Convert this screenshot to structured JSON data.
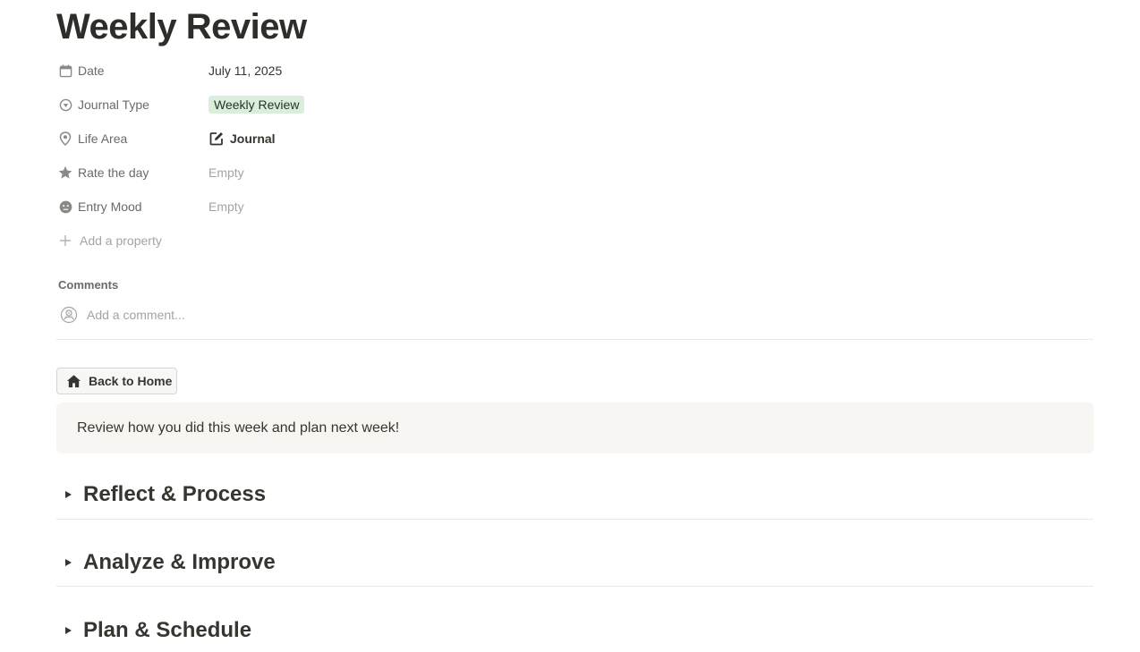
{
  "page": {
    "title": "Weekly Review"
  },
  "properties": [
    {
      "key": "Date",
      "icon": "calendar-icon",
      "value": "July 11, 2025"
    },
    {
      "key": "Journal Type",
      "icon": "select-icon",
      "value": "Weekly Review"
    },
    {
      "key": "Life Area",
      "icon": "location-pin-icon",
      "value": "Journal",
      "value_icon": "edit-note-icon"
    },
    {
      "key": "Rate the day",
      "icon": "star-icon",
      "value": "Empty"
    },
    {
      "key": "Entry Mood",
      "icon": "mood-face-icon",
      "value": "Empty"
    }
  ],
  "add_property": {
    "label": "Add a property",
    "icon": "plus-icon"
  },
  "comments": {
    "label": "Comments",
    "placeholder": "Add a comment...",
    "avatar_icon": "avatar-icon"
  },
  "back_button": {
    "label": "Back to Home",
    "icon": "home-icon"
  },
  "callout": {
    "text": "Review how you did this week and plan next week!"
  },
  "toggles": [
    {
      "label": "Reflect & Process"
    },
    {
      "label": "Analyze & Improve"
    },
    {
      "label": "Plan & Schedule"
    }
  ],
  "colors": {
    "tag_bg": "#dbeddb",
    "tag_text": "#1c3829",
    "callout_bg": "#f7f6f3"
  }
}
